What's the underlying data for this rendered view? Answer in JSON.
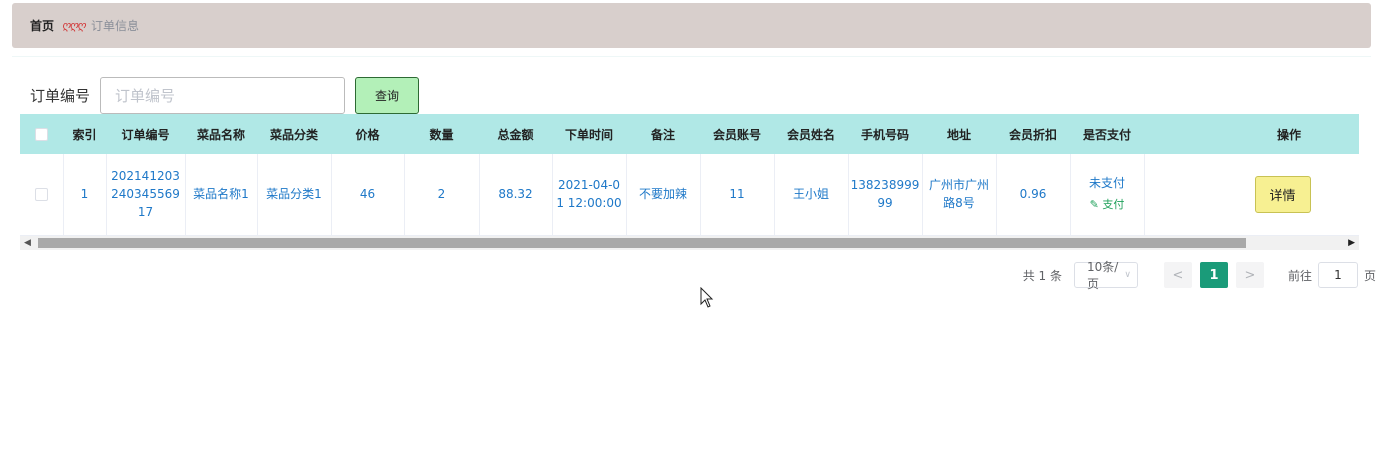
{
  "breadcrumb": {
    "home": "首页",
    "separator": "ღღღ",
    "current": "订单信息"
  },
  "search": {
    "label": "订单编号",
    "placeholder": "订单编号",
    "value": "",
    "button_label": "查询"
  },
  "table": {
    "columns": [
      "",
      "索引",
      "订单编号",
      "菜品名称",
      "菜品分类",
      "价格",
      "数量",
      "总金额",
      "下单时间",
      "备注",
      "会员账号",
      "会员姓名",
      "手机号码",
      "地址",
      "会员折扣",
      "是否支付",
      "操作"
    ],
    "rows": [
      {
        "index": "1",
        "order_no": "20214120324034556917",
        "dish_name": "菜品名称1",
        "dish_category": "菜品分类1",
        "price": "46",
        "quantity": "2",
        "total": "88.32",
        "order_time": "2021-04-01 12:00:00",
        "note": "不要加辣",
        "member_account": "11",
        "member_name": "王小姐",
        "phone": "13823899999",
        "address": "广州市广州路8号",
        "discount": "0.96",
        "pay_status": "未支付",
        "pay_link": "支付",
        "action": "详情"
      }
    ]
  },
  "pagination": {
    "total": "共 1 条",
    "page_size": "10条/页",
    "prev": "<",
    "current_page": "1",
    "next": ">",
    "goto_label": "前往",
    "goto_value": "1",
    "goto_unit": "页"
  },
  "colors": {
    "header_bg": "#b0e8e6",
    "breadcrumb_bg": "#d8cfcc",
    "search_button_bg": "#b3f0b8",
    "detail_button_bg": "#f7f092",
    "active_page": "#1a9b79",
    "link_text": "#1e78c8"
  }
}
